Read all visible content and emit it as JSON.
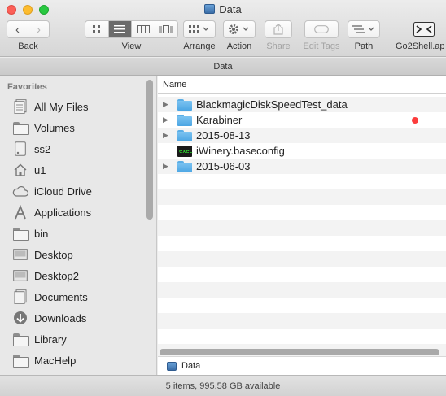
{
  "window": {
    "title": "Data"
  },
  "toolbar": {
    "back_label": "Back",
    "view_label": "View",
    "arrange_label": "Arrange",
    "action_label": "Action",
    "share_label": "Share",
    "edit_tags_label": "Edit Tags",
    "path_label": "Path",
    "go2shell_label": "Go2Shell.ap"
  },
  "pathbar": {
    "title": "Data"
  },
  "sidebar": {
    "heading": "Favorites",
    "items": [
      {
        "label": "All My Files",
        "icon": "all-files-icon"
      },
      {
        "label": "Volumes",
        "icon": "folder-icon"
      },
      {
        "label": "ss2",
        "icon": "drive-icon"
      },
      {
        "label": "u1",
        "icon": "home-icon"
      },
      {
        "label": "iCloud Drive",
        "icon": "cloud-icon"
      },
      {
        "label": "Applications",
        "icon": "applications-icon"
      },
      {
        "label": "bin",
        "icon": "folder-icon"
      },
      {
        "label": "Desktop",
        "icon": "desktop-icon"
      },
      {
        "label": "Desktop2",
        "icon": "desktop-icon"
      },
      {
        "label": "Documents",
        "icon": "documents-icon"
      },
      {
        "label": "Downloads",
        "icon": "downloads-icon"
      },
      {
        "label": "Library",
        "icon": "folder-icon"
      },
      {
        "label": "MacHelp",
        "icon": "folder-icon"
      }
    ]
  },
  "file_list": {
    "column_name": "Name",
    "rows": [
      {
        "name": "BlackmagicDiskSpeedTest_data",
        "kind": "folder",
        "expandable": true,
        "tag": ""
      },
      {
        "name": "Karabiner",
        "kind": "folder",
        "expandable": true,
        "tag": "red"
      },
      {
        "name": "2015-08-13",
        "kind": "folder",
        "expandable": true,
        "tag": ""
      },
      {
        "name": "iWinery.baseconfig",
        "kind": "exec",
        "expandable": false,
        "tag": ""
      },
      {
        "name": "2015-06-03",
        "kind": "folder",
        "expandable": true,
        "tag": ""
      }
    ]
  },
  "bottom_path": {
    "label": "Data"
  },
  "status": {
    "text": "5 items, 995.58 GB available"
  },
  "colors": {
    "tag_red": "#fc3c3c",
    "folder_blue": "#4ba5e3"
  }
}
